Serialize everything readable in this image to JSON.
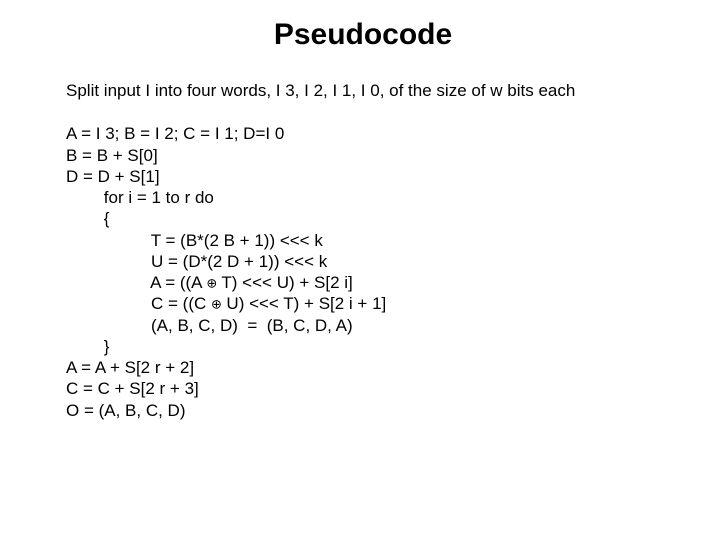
{
  "title": "Pseudocode",
  "intro": "Split input I into four words, I 3, I 2, I 1, I 0, of the size of w bits each",
  "code": {
    "l1": "A = I 3; B = I 2; C = I 1; D=I 0",
    "l2": "B = B + S[0]",
    "l3": "D = D + S[1]",
    "l4": "        for i = 1 to r do",
    "l5": "        {",
    "l6": "                  T = (B*(2 B + 1)) <<< k",
    "l7": "                  U = (D*(2 D + 1)) <<< k",
    "l8a": "                  A = ((A ",
    "l8b": " T) <<< U) + S[2 i]",
    "l9a": "                  C = ((C ",
    "l9b": " U) <<< T) + S[2 i + 1]",
    "l10": "                  (A, B, C, D)  =  (B, C, D, A)",
    "l11": "        }",
    "l12": "A = A + S[2 r + 2]",
    "l13": "C = C + S[2 r + 3]",
    "l14": "O = (A, B, C, D)"
  },
  "sym": {
    "xor": "⊕"
  }
}
